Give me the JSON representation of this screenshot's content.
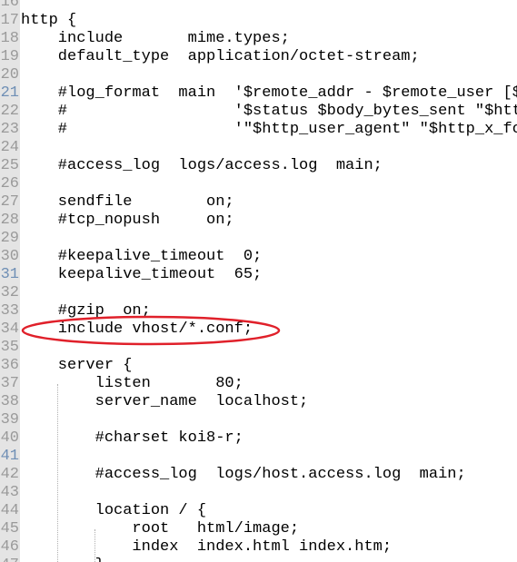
{
  "editor": {
    "first_line_number": 16,
    "lines": [
      "",
      "http {",
      "    include       mime.types;",
      "    default_type  application/octet-stream;",
      "",
      "    #log_format  main  '$remote_addr - $remote_user [$t",
      "    #                  '$status $body_bytes_sent \"$http",
      "    #                  '\"$http_user_agent\" \"$http_x_for",
      "",
      "    #access_log  logs/access.log  main;",
      "",
      "    sendfile        on;",
      "    #tcp_nopush     on;",
      "",
      "    #keepalive_timeout  0;",
      "    keepalive_timeout  65;",
      "",
      "    #gzip  on;",
      "    include vhost/*.conf;",
      "",
      "    server {",
      "        listen       80;",
      "        server_name  localhost;",
      "",
      "        #charset koi8-r;",
      "",
      "        #access_log  logs/host.access.log  main;",
      "",
      "        location / {",
      "            root   html/image;",
      "            index  index.html index.htm;",
      "        }"
    ],
    "highlighted_line_number": 34
  },
  "colors": {
    "gutter_bg": "#e4e4e4",
    "line_number": "#9a9a9a",
    "annotation": "#e0202a"
  }
}
